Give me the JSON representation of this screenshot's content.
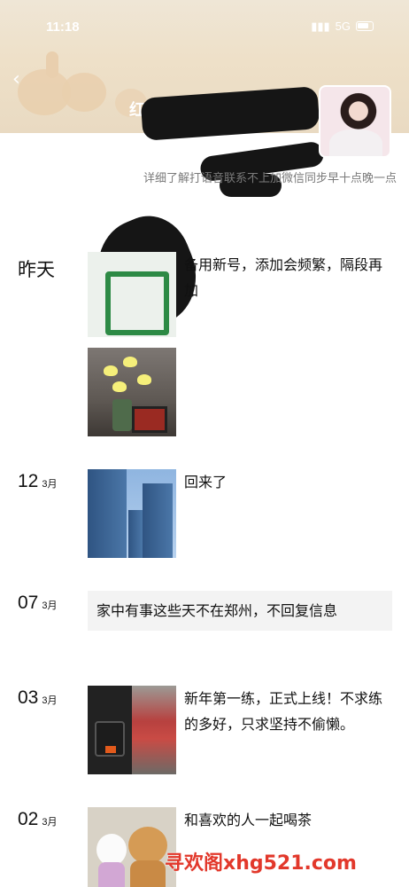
{
  "status_bar": {
    "time": "11:18",
    "network": "5G"
  },
  "cover": {
    "name_prefix": "红"
  },
  "signature": {
    "text": "详细了解打语音联系不上加微信同步早十点晚一点"
  },
  "timeline": [
    {
      "day": "昨天",
      "month": "",
      "caption": "备用新号，添加会频繁，隔段再加"
    },
    {
      "day": "",
      "month": "",
      "caption": ""
    },
    {
      "day": "12",
      "month": "3月",
      "caption": "回来了"
    },
    {
      "day": "07",
      "month": "3月",
      "caption": "家中有事这些天不在郑州，不回复信息"
    },
    {
      "day": "03",
      "month": "3月",
      "caption": "新年第一练，正式上线！不求练的多好，只求坚持不偷懒。"
    },
    {
      "day": "02",
      "month": "3月",
      "caption": "和喜欢的人一起喝茶"
    }
  ],
  "watermark": "寻欢阁xhg521.com",
  "icons": {
    "back": "back-arrow-icon",
    "battery": "battery-icon",
    "signal": "signal-icon"
  },
  "colors": {
    "watermark": "#e2382b",
    "card_bg": "#f3f3f3",
    "muted_text": "#7a7a7a"
  }
}
